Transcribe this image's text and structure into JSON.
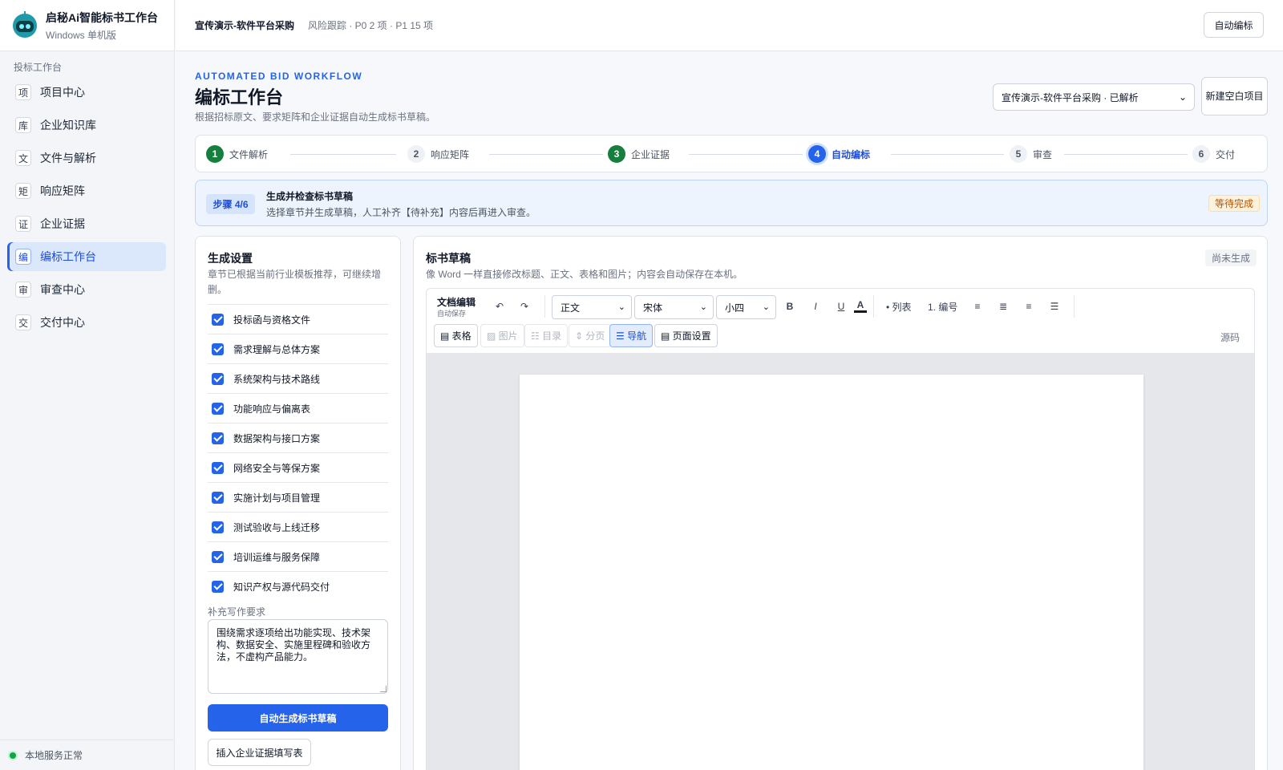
{
  "brand": {
    "title": "启秘Ai智能标书工作台",
    "subtitle": "Windows 单机版"
  },
  "sidebar": {
    "group_label": "投标工作台",
    "items": [
      {
        "icon": "项",
        "label": "项目中心"
      },
      {
        "icon": "库",
        "label": "企业知识库"
      },
      {
        "icon": "文",
        "label": "文件与解析"
      },
      {
        "icon": "矩",
        "label": "响应矩阵"
      },
      {
        "icon": "证",
        "label": "企业证据"
      },
      {
        "icon": "编",
        "label": "编标工作台",
        "active": true
      },
      {
        "icon": "审",
        "label": "审查中心"
      },
      {
        "icon": "交",
        "label": "交付中心"
      }
    ],
    "service_status": "本地服务正常",
    "status_color": "#16a34a"
  },
  "topbar": {
    "project": "宣传演示-软件平台采购",
    "risk": "风险跟踪 · P0 2 项 · P1 15 项",
    "auto_button": "自动编标"
  },
  "header": {
    "eyebrow": "AUTOMATED BID WORKFLOW",
    "title": "编标工作台",
    "description": "根据招标原文、要求矩阵和企业证据自动生成标书草稿。",
    "project_select": "宣传演示-软件平台采购 · 已解析",
    "new_project_button": "新建空白项目"
  },
  "steps": [
    {
      "num": "1",
      "label": "文件解析",
      "state": "done"
    },
    {
      "num": "2",
      "label": "响应矩阵",
      "state": "pending"
    },
    {
      "num": "3",
      "label": "企业证据",
      "state": "done"
    },
    {
      "num": "4",
      "label": "自动编标",
      "state": "active"
    },
    {
      "num": "5",
      "label": "审查",
      "state": "pending"
    },
    {
      "num": "6",
      "label": "交付",
      "state": "pending"
    }
  ],
  "banner": {
    "badge": "步骤 4/6",
    "title": "生成并检查标书草稿",
    "description": "选择章节并生成草稿，人工补齐【待补充】内容后再进入审查。",
    "status": "等待完成"
  },
  "settings": {
    "title": "生成设置",
    "description": "章节已根据当前行业模板推荐，可继续增删。",
    "chapters": [
      "投标函与资格文件",
      "需求理解与总体方案",
      "系统架构与技术路线",
      "功能响应与偏离表",
      "数据架构与接口方案",
      "网络安全与等保方案",
      "实施计划与项目管理",
      "测试验收与上线迁移",
      "培训运维与服务保障",
      "知识产权与源代码交付"
    ],
    "requirements_label": "补充写作要求",
    "requirements_value": "围绕需求逐项给出功能实现、技术架构、数据安全、实施里程碑和验收方法，不虚构产品能力。",
    "generate_button": "自动生成标书草稿",
    "insert_button": "插入企业证据填写表"
  },
  "draft": {
    "title": "标书草稿",
    "description": "像 Word 一样直接修改标题、正文、表格和图片；内容会自动保存在本机。",
    "status": "尚未生成",
    "editor": {
      "title": "文档编辑",
      "subtitle": "自动保存",
      "undo": "↶",
      "redo": "↷",
      "style_select": "正文",
      "font_select": "宋体",
      "size_select": "小四",
      "bold": "B",
      "italic": "I",
      "underline": "U",
      "font_color": "A",
      "bullet_list": "• 列表",
      "numbered_list": "1. 编号",
      "align_left": "≡",
      "align_center": "≣",
      "align_right": "≡",
      "justify": "☰",
      "table": "▤ 表格",
      "image": "▨ 图片",
      "toc": "☷ 目录",
      "page_break": "⇕ 分页",
      "navigation": "☰ 导航",
      "page_setup": "▤ 页面设置",
      "source": "源码"
    }
  }
}
